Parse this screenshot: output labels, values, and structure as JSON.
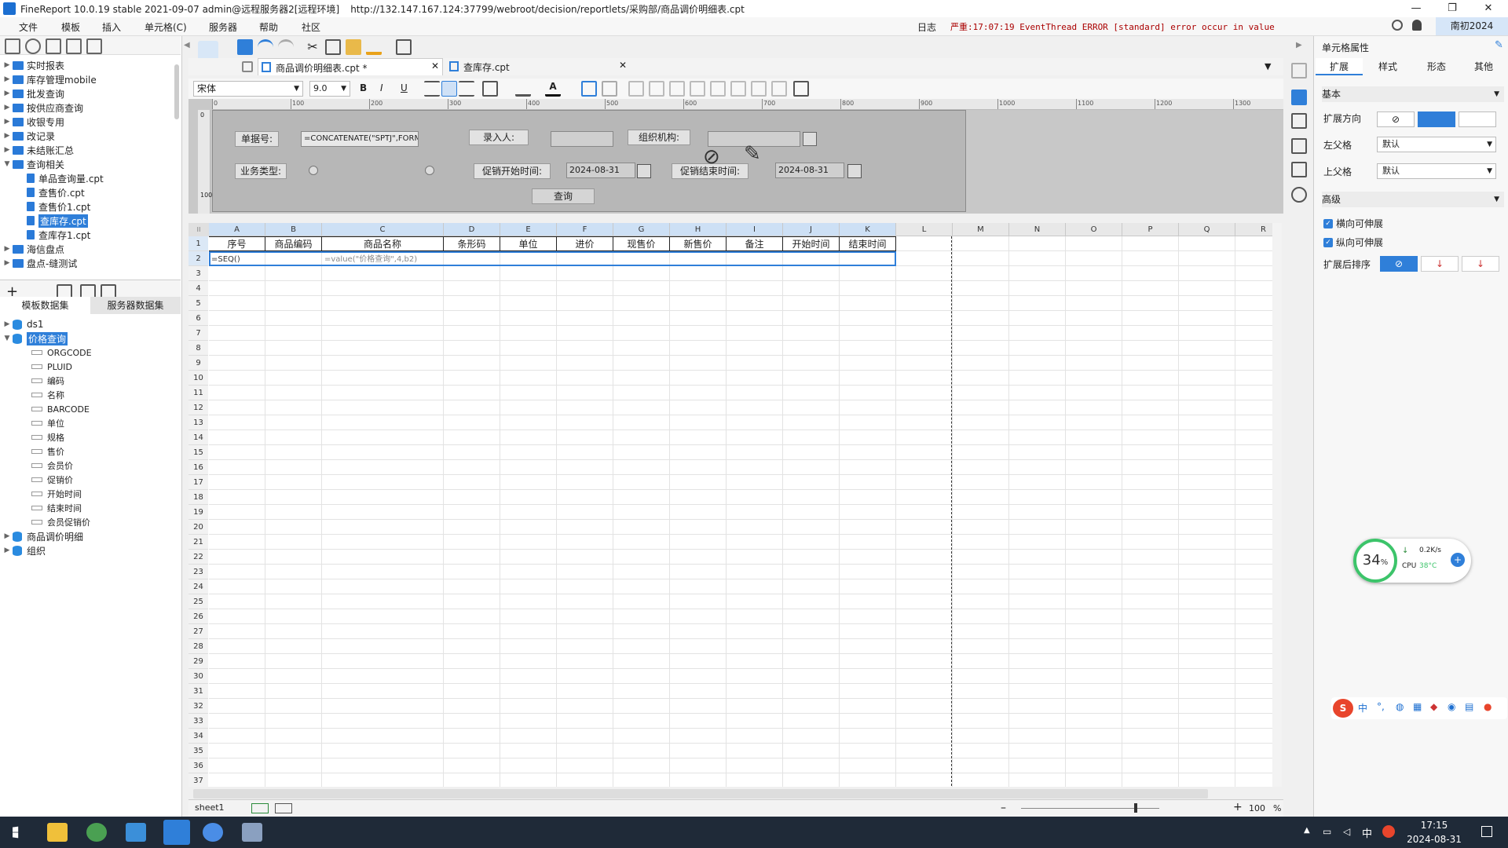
{
  "window": {
    "title": "FineReport 10.0.19 stable 2021-09-07 admin@远程服务器2[远程环境]",
    "url": "http://132.147.167.124:37799/webroot/decision/reportlets/采购部/商品调价明细表.cpt"
  },
  "menu": [
    "文件",
    "模板",
    "插入",
    "单元格(C)",
    "服务器",
    "帮助",
    "社区"
  ],
  "status": {
    "log_label": "日志",
    "error_text": "严重:17:07:19 EventThread ERROR [standard] error occur in value",
    "user": "南初2024"
  },
  "tree": [
    {
      "label": "实时报表",
      "type": "folder",
      "level": 0
    },
    {
      "label": "库存管理mobile",
      "type": "folder",
      "level": 0
    },
    {
      "label": "批发查询",
      "type": "folder",
      "level": 0
    },
    {
      "label": "按供应商查询",
      "type": "folder",
      "level": 0
    },
    {
      "label": "收银专用",
      "type": "folder",
      "level": 0
    },
    {
      "label": "改记录",
      "type": "folder",
      "level": 0
    },
    {
      "label": "未结账汇总",
      "type": "folder",
      "level": 0
    },
    {
      "label": "查询相关",
      "type": "folder",
      "level": 0,
      "open": true
    },
    {
      "label": "单品查询量.cpt",
      "type": "cpt",
      "level": 1
    },
    {
      "label": "查售价.cpt",
      "type": "cpt",
      "level": 1
    },
    {
      "label": "查售价1.cpt",
      "type": "cpt",
      "level": 1
    },
    {
      "label": "查库存.cpt",
      "type": "cpt",
      "level": 1,
      "selected": true
    },
    {
      "label": "查库存1.cpt",
      "type": "cpt",
      "level": 1
    },
    {
      "label": "海信盘点",
      "type": "folder",
      "level": 0
    },
    {
      "label": "盘点-缝测试",
      "type": "folder",
      "level": 0
    }
  ],
  "dataset_tabs": [
    "模板数据集",
    "服务器数据集"
  ],
  "datasets": [
    {
      "label": "ds1",
      "type": "db",
      "level": 0
    },
    {
      "label": "价格查询",
      "type": "db",
      "level": 0,
      "selected": true,
      "open": true
    },
    {
      "label": "ORGCODE",
      "type": "field",
      "level": 1
    },
    {
      "label": "PLUID",
      "type": "field",
      "level": 1
    },
    {
      "label": "编码",
      "type": "field",
      "level": 1
    },
    {
      "label": "名称",
      "type": "field",
      "level": 1
    },
    {
      "label": "BARCODE",
      "type": "field",
      "level": 1
    },
    {
      "label": "单位",
      "type": "field",
      "level": 1
    },
    {
      "label": "规格",
      "type": "field",
      "level": 1
    },
    {
      "label": "售价",
      "type": "field",
      "level": 1
    },
    {
      "label": "会员价",
      "type": "field",
      "level": 1
    },
    {
      "label": "促销价",
      "type": "field",
      "level": 1
    },
    {
      "label": "开始时间",
      "type": "field",
      "level": 1
    },
    {
      "label": "结束时间",
      "type": "field",
      "level": 1
    },
    {
      "label": "会员促销价",
      "type": "field",
      "level": 1
    },
    {
      "label": "商品调价明细",
      "type": "db",
      "level": 0
    },
    {
      "label": "组织",
      "type": "db",
      "level": 0
    }
  ],
  "doc_tabs": [
    {
      "label": "商品调价明细表.cpt *",
      "active": true
    },
    {
      "label": "查库存.cpt",
      "active": false
    }
  ],
  "format": {
    "font": "宋体",
    "size": "9.0"
  },
  "ruler_ticks": [
    "0",
    "100",
    "200",
    "300",
    "400",
    "500",
    "600",
    "700",
    "800",
    "900",
    "1000",
    "1100",
    "1200",
    "1300"
  ],
  "vruler_ticks": [
    "0",
    "100"
  ],
  "params": {
    "doc_no_label": "单据号:",
    "doc_no_value": "=CONCATENATE(\"SPTJ\",FORMAT(NOW",
    "entry_label": "录入人:",
    "org_label": "组织机构:",
    "biz_label": "业务类型:",
    "start_label": "促销开始时间:",
    "start_value": "2024-08-31",
    "end_label": "促销结束时间:",
    "end_value": "2024-08-31",
    "query_button": "查询"
  },
  "columns": [
    "A",
    "B",
    "C",
    "D",
    "E",
    "F",
    "G",
    "H",
    "I",
    "J",
    "K",
    "L",
    "M",
    "N",
    "O",
    "P",
    "Q",
    "R"
  ],
  "header_row": [
    "序号",
    "商品编码",
    "商品名称",
    "条形码",
    "单位",
    "进价",
    "现售价",
    "新售价",
    "备注",
    "开始时间",
    "结束时间"
  ],
  "formula_row": [
    "=SEQ()",
    "",
    "=value(\"价格查询\",4,b2)"
  ],
  "row_count": 37,
  "sheet_tab": "sheet1",
  "zoom": "100",
  "right_panel": {
    "title": "单元格属性",
    "tabs": [
      "扩展",
      "样式",
      "形态",
      "其他"
    ],
    "basic": "基本",
    "expand_dir": "扩展方向",
    "left_parent": "左父格",
    "left_parent_value": "默认",
    "top_parent": "上父格",
    "top_parent_value": "默认",
    "advanced": "高级",
    "h_expand": "横向可伸展",
    "v_expand": "纵向可伸展",
    "sort": "扩展后排序"
  },
  "monitor": {
    "percent": "34",
    "net": "0.2K/s",
    "cpu_label": "CPU",
    "cpu_temp": "38°C"
  },
  "ime": {
    "lang": "中"
  },
  "clock": {
    "time": "17:15",
    "date": "2024-08-31",
    "tray_lang": "中"
  },
  "colors": {
    "accent": "#2f7fd9",
    "taskbar": "#1f2a38",
    "selection": "#2f7fd9"
  }
}
